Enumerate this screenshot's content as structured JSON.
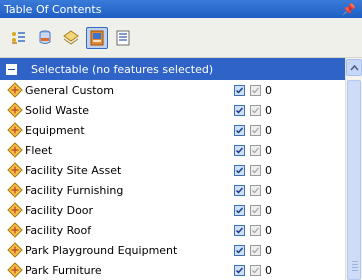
{
  "window": {
    "title": "Table Of Contents",
    "pin_glyph": "⭿"
  },
  "toolbar": {
    "buttons": [
      {
        "name": "list-by-drawing-order-icon",
        "active": false
      },
      {
        "name": "list-by-source-icon",
        "active": false
      },
      {
        "name": "list-by-visibility-icon",
        "active": false
      },
      {
        "name": "list-by-selection-icon",
        "active": true
      },
      {
        "name": "options-icon",
        "active": false
      }
    ]
  },
  "group": {
    "label": "Selectable (no features selected)"
  },
  "layers": [
    {
      "label": "General Custom",
      "count": "0"
    },
    {
      "label": "Solid Waste",
      "count": "0"
    },
    {
      "label": "Equipment",
      "count": "0"
    },
    {
      "label": "Fleet",
      "count": "0"
    },
    {
      "label": "Facility Site Asset",
      "count": "0"
    },
    {
      "label": "Facility Furnishing",
      "count": "0"
    },
    {
      "label": "Facility Door",
      "count": "0"
    },
    {
      "label": "Facility Roof",
      "count": "0"
    },
    {
      "label": "Park Playground Equipment",
      "count": "0"
    },
    {
      "label": "Park Furniture",
      "count": "0"
    }
  ],
  "colors": {
    "titlebar": "#1f5fc4",
    "group_header": "#2f63c8",
    "checkbox_blue": "#3a6fc1"
  }
}
